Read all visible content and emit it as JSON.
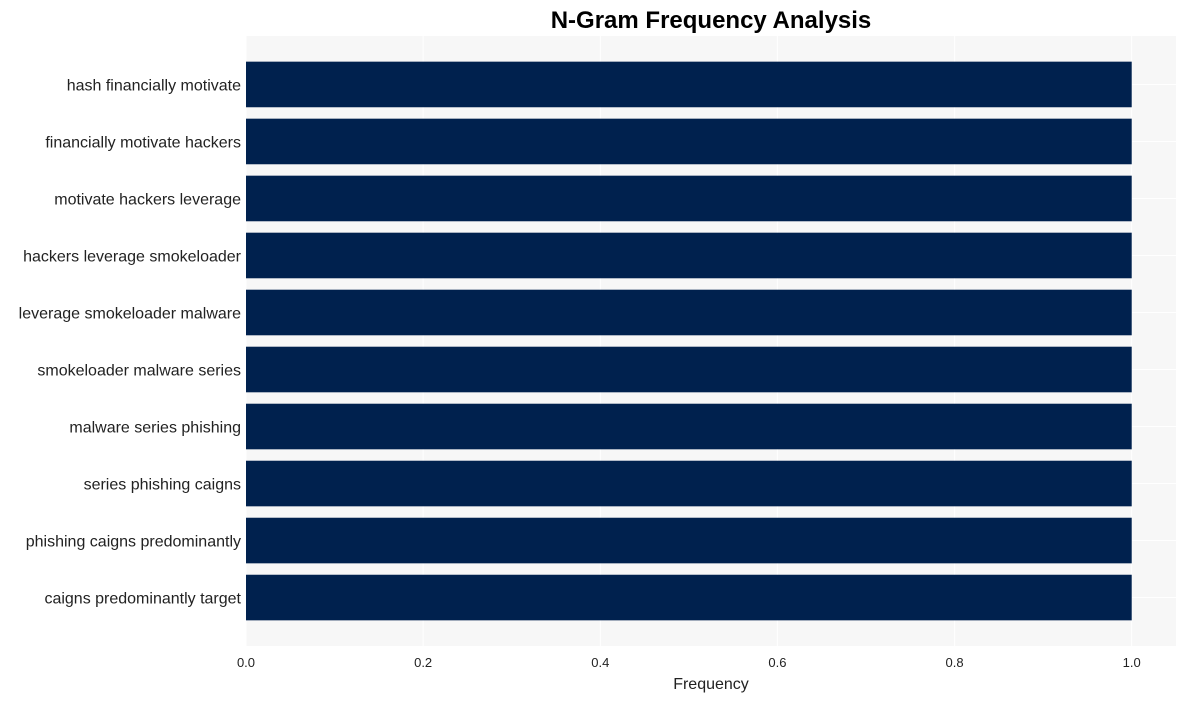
{
  "chart_data": {
    "type": "bar",
    "orientation": "horizontal",
    "title": "N-Gram Frequency Analysis",
    "xlabel": "Frequency",
    "ylabel": "",
    "xlim": [
      0,
      1.05
    ],
    "xticks": [
      "0.0",
      "0.2",
      "0.4",
      "0.6",
      "0.8",
      "1.0"
    ],
    "grid": true,
    "categories": [
      "hash financially motivate",
      "financially motivate hackers",
      "motivate hackers leverage",
      "hackers leverage smokeloader",
      "leverage smokeloader malware",
      "smokeloader malware series",
      "malware series phishing",
      "series phishing caigns",
      "phishing caigns predominantly",
      "caigns predominantly target"
    ],
    "values": [
      1,
      1,
      1,
      1,
      1,
      1,
      1,
      1,
      1,
      1
    ],
    "colors": {
      "bar": "#00214e",
      "plot_bg": "#f7f7f7",
      "grid": "#ffffff"
    }
  }
}
